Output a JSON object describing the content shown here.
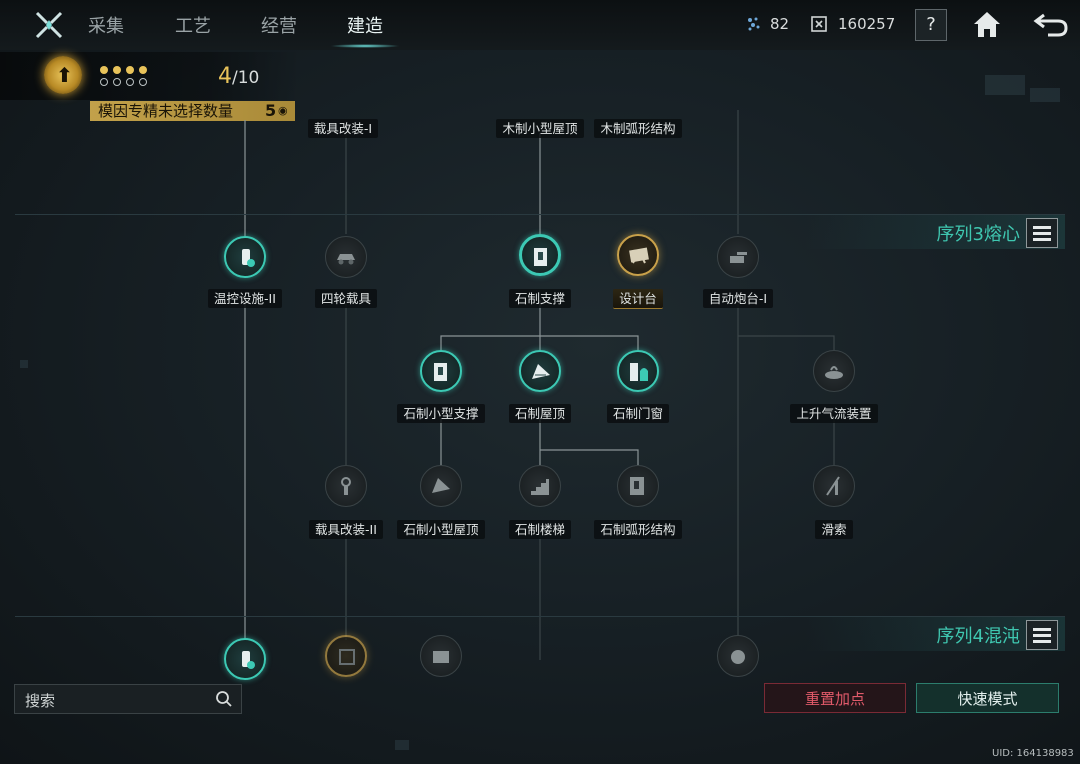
{
  "nav": {
    "tabs": [
      {
        "label": "采集"
      },
      {
        "label": "工艺"
      },
      {
        "label": "经营"
      },
      {
        "label": "建造"
      }
    ],
    "active_tab": "建造"
  },
  "resources": {
    "crystal": "82",
    "currency": "160257"
  },
  "help_label": "?",
  "level": {
    "current": "4",
    "max": "/10",
    "dots_filled": 4,
    "dots_total": 8
  },
  "unselected_banner": {
    "label": "模因专精未选择数量",
    "value": "5"
  },
  "sequences": [
    {
      "title": "序列3熔心"
    },
    {
      "title": "序列4混沌"
    }
  ],
  "top_nodes": [
    {
      "label": "载具改装-I"
    },
    {
      "label": "木制小型屋顶"
    },
    {
      "label": "木制弧形结构"
    }
  ],
  "nodes": {
    "wenkong": {
      "label": "温控设施-II",
      "icon": "temperature-tower-icon"
    },
    "silun": {
      "label": "四轮载具",
      "icon": "car-icon"
    },
    "shizhi_zhicheng": {
      "label": "石制支撑",
      "icon": "stone-support-icon"
    },
    "shejitai": {
      "label": "设计台",
      "icon": "design-table-icon"
    },
    "paotai": {
      "label": "自动炮台-I",
      "icon": "turret-icon"
    },
    "xiaoxing_zhicheng": {
      "label": "石制小型支撑",
      "icon": "stone-support-icon"
    },
    "wuding": {
      "label": "石制屋顶",
      "icon": "roof-icon"
    },
    "menchuang": {
      "label": "石制门窗",
      "icon": "door-window-icon"
    },
    "qiliu": {
      "label": "上升气流装置",
      "icon": "updraft-icon"
    },
    "zaiju2": {
      "label": "载具改装-II",
      "icon": "wrench-icon"
    },
    "xiaoxing_wuding": {
      "label": "石制小型屋顶",
      "icon": "roof-icon"
    },
    "louti": {
      "label": "石制楼梯",
      "icon": "stairs-icon"
    },
    "huxing": {
      "label": "石制弧形结构",
      "icon": "arch-icon"
    },
    "huasuo": {
      "label": "滑索",
      "icon": "zipline-icon"
    }
  },
  "search": {
    "placeholder": "搜索"
  },
  "buttons": {
    "reset": "重置加点",
    "fast_mode": "快速模式"
  },
  "uid": "UID: 164138983"
}
